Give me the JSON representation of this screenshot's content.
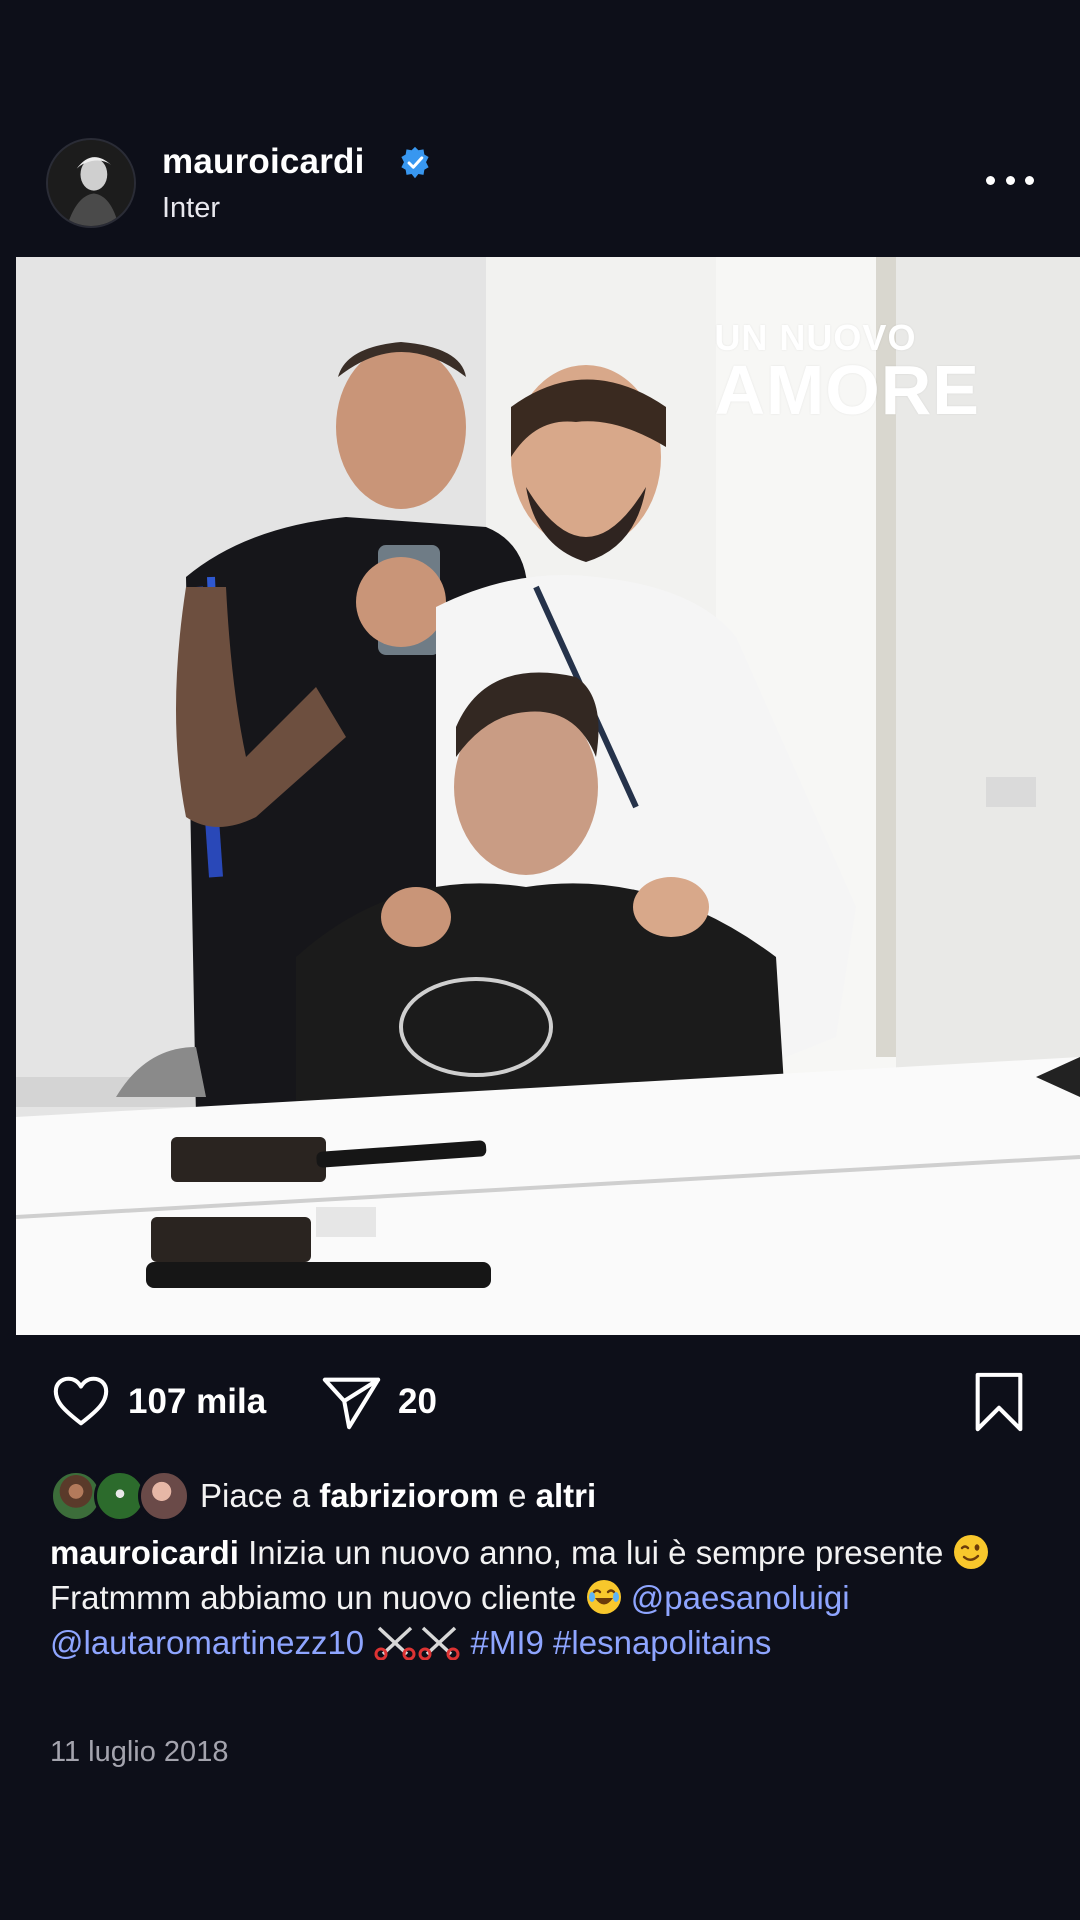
{
  "post": {
    "username": "mauroicardi",
    "location": "Inter",
    "verified": true,
    "image_overlay": {
      "line1": "UN NUOVO",
      "line2": "AMORE"
    },
    "likes_count": "107 mila",
    "shares_count": "20",
    "liked_by_prefix": "Piace a ",
    "liked_by_user": "fabriziorom",
    "liked_by_mid": " e ",
    "liked_by_others": "altri",
    "caption": {
      "username": "mauroicardi",
      "text1": " Inizia un nuovo anno, ma lui è sempre presente ",
      "text2": "Fratmmm abbiamo un nuovo cliente ",
      "mention1": "@paesanoluigi",
      "mention2": "@lautaromartinezz10",
      "hashtag1": "#MI9",
      "hashtag2": "#lesnapolitains"
    },
    "date": "11 luglio 2018"
  },
  "icons": {
    "verified": "verified-badge-icon",
    "more": "more-options-icon",
    "like": "heart-icon",
    "share": "send-icon",
    "save": "bookmark-icon"
  },
  "colors": {
    "background": "#0d0f19",
    "link": "#8ea5ff",
    "verified": "#3897f0"
  }
}
